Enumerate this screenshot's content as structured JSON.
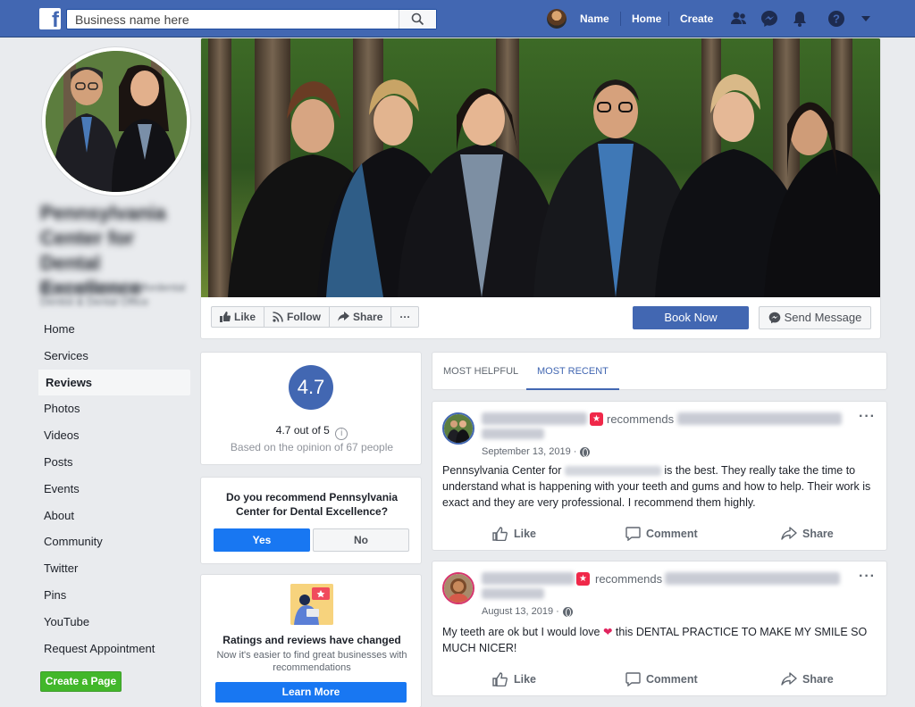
{
  "topbar": {
    "search_placeholder": "Business name here",
    "nav": {
      "name": "Name",
      "home": "Home",
      "create": "Create"
    }
  },
  "page": {
    "name": "Pennsylvania Center for Dental Excellence",
    "handle": "@pennsylvaniacenterfordental Dentist & Dental Office"
  },
  "sidebar": {
    "items": [
      {
        "label": "Home"
      },
      {
        "label": "Services"
      },
      {
        "label": "Reviews",
        "active": true
      },
      {
        "label": "Photos"
      },
      {
        "label": "Videos"
      },
      {
        "label": "Posts"
      },
      {
        "label": "Events"
      },
      {
        "label": "About"
      },
      {
        "label": "Community"
      },
      {
        "label": "Twitter"
      },
      {
        "label": "Pins"
      },
      {
        "label": "YouTube"
      },
      {
        "label": "Request Appointment"
      }
    ],
    "create_page": "Create a Page"
  },
  "cover_actions": {
    "like": "Like",
    "follow": "Follow",
    "share": "Share",
    "more": "···",
    "book_now": "Book Now",
    "send_message": "Send Message"
  },
  "rating": {
    "score": "4.7",
    "out_of": "4.7 out of 5",
    "info": "i",
    "based_on": "Based on the opinion of 67 people"
  },
  "recommend": {
    "question": "Do you recommend Pennsylvania Center for Dental Excellence?",
    "yes": "Yes",
    "no": "No"
  },
  "changed": {
    "title": "Ratings and reviews have changed",
    "subtitle": "Now it's easier to find great businesses with recommendations",
    "button": "Learn More"
  },
  "tabs": [
    {
      "label": "MOST HELPFUL"
    },
    {
      "label": "MOST RECENT",
      "active": true
    }
  ],
  "reviews": [
    {
      "recommends": "recommends",
      "date": "September 13, 2019 · ",
      "text_before": "Pennsylvania Center for ",
      "text_after": " is the best. They really take the time to understand what is happening with your teeth and gums and how to help. Their work is exact and they are very professional. I recommend them highly.",
      "like": "Like",
      "comment": "Comment",
      "share": "Share"
    },
    {
      "recommends": "recommends",
      "date": "August 13, 2019 · ",
      "text_before": "My teeth are ok but I would love ",
      "text_after": " this DENTAL PRACTICE TO MAKE MY SMILE SO MUCH NICER!",
      "like": "Like",
      "comment": "Comment",
      "share": "Share"
    }
  ],
  "colors": {
    "brand_blue": "#4267b2",
    "action_blue": "#1877f2",
    "create_green": "#42b72a",
    "badge_red": "#f02849",
    "background": "#e9ebee"
  }
}
